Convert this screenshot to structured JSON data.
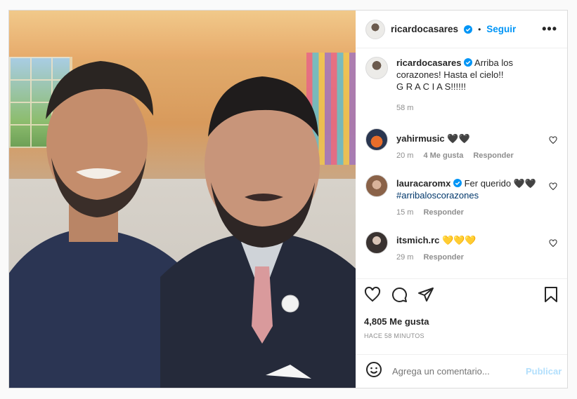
{
  "post": {
    "author": "ricardocasares",
    "follow_label": "Seguir",
    "separator": "•",
    "more_label": "•••",
    "caption": {
      "username": "ricardocasares",
      "text_line1": "Arriba los",
      "text_line2": "corazones! Hasta el cielo!!",
      "text_line3": "G R A C I A S!!!!!!",
      "time": "58 m"
    },
    "comments": [
      {
        "username": "yahirmusic",
        "text": "🖤🖤",
        "time": "20 m",
        "likes": "4 Me gusta",
        "reply": "Responder"
      },
      {
        "username": "lauracaromx",
        "text": "Fer querido 🖤🖤",
        "hashtag": "#arribaloscorazones",
        "time": "15 m",
        "reply": "Responder"
      },
      {
        "username": "itsmich.rc",
        "text": "💛💛💛",
        "time": "29 m",
        "reply": "Responder"
      }
    ],
    "likes_count": "4,805 Me gusta",
    "posted_ago": "HACE 58 MINUTOS",
    "comment_placeholder": "Agrega un comentario...",
    "publish_label": "Publicar"
  },
  "colors": {
    "link": "#0095f6",
    "publish_disabled": "#b2dffc",
    "muted": "#8e8e8e",
    "text": "#262626"
  }
}
